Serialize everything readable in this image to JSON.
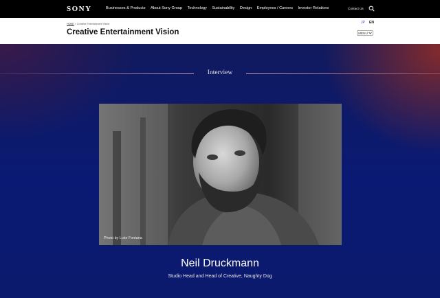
{
  "header": {
    "logo": "SONY",
    "nav": [
      "Businesses & Products",
      "About Sony Group",
      "Technology",
      "Sustainability",
      "Design",
      "Employees / Careers",
      "Investor Relations"
    ],
    "contact": "Contact Us"
  },
  "subheader": {
    "breadcrumb_home": "HOME",
    "breadcrumb_sep": ">",
    "breadcrumb_current": "Creative Entertainment Vision",
    "title": "Creative Entertainment Vision",
    "lang_ja": "JP",
    "lang_en": "EN",
    "menu_label": "MENU"
  },
  "main": {
    "section_label": "Interview",
    "photo_credit": "Photo by Luke Fontana",
    "person_name": "Neil Druckmann",
    "person_role": "Studio Head and Head of Creative, Naughty Dog"
  },
  "colors": {
    "topbar": "#000000",
    "hero_blue": "#0a1a74",
    "accent_red": "#962d23"
  }
}
